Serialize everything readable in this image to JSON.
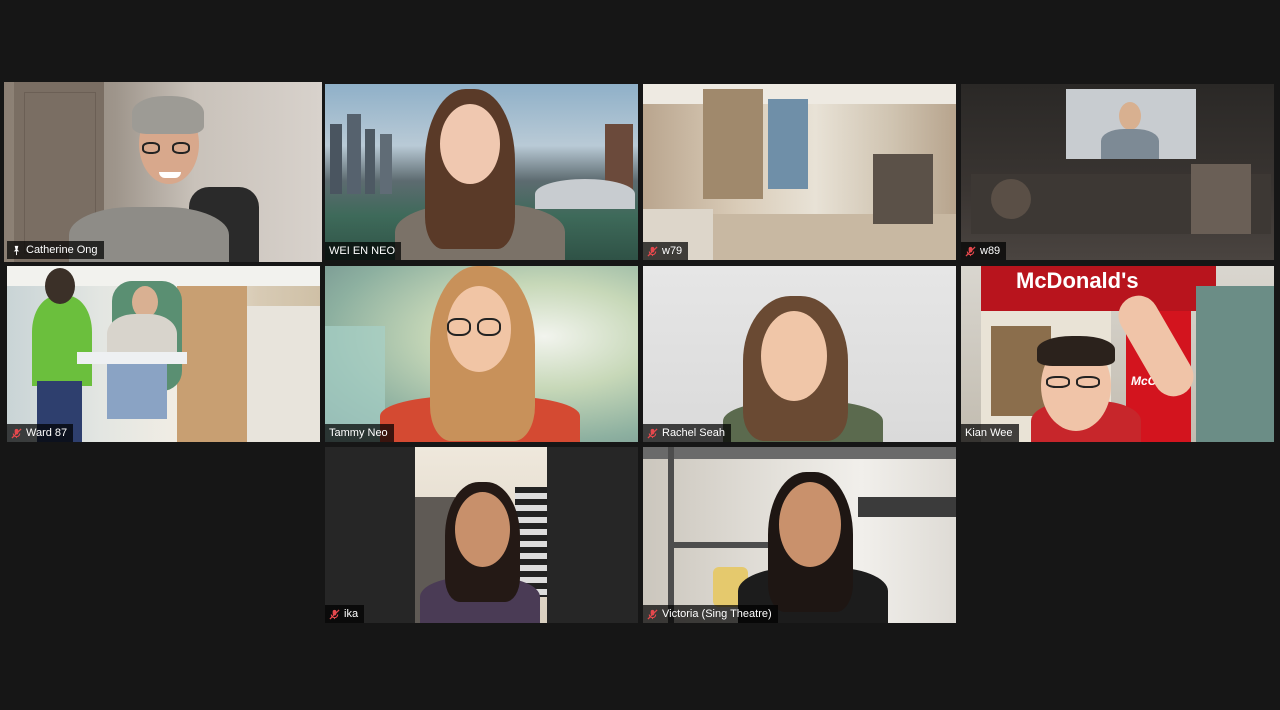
{
  "colors": {
    "background": "#161616",
    "active_speaker_border": "#d7e97e",
    "muted_icon": "#e5484d",
    "name_tag_bg": "#000000"
  },
  "participants": [
    {
      "name": "Catherine Ong",
      "icon": "pin-icon",
      "active_speaker": true
    },
    {
      "name": "WEI EN NEO",
      "icon": "",
      "active_speaker": false
    },
    {
      "name": "w79",
      "icon": "mic-muted-icon",
      "active_speaker": false
    },
    {
      "name": "w89",
      "icon": "mic-muted-icon",
      "active_speaker": false
    },
    {
      "name": "Ward 87",
      "icon": "mic-muted-icon",
      "active_speaker": false
    },
    {
      "name": "Tammy Neo",
      "icon": "",
      "active_speaker": false
    },
    {
      "name": "Rachel Seah",
      "icon": "mic-muted-icon",
      "active_speaker": false
    },
    {
      "name": "Kian Wee",
      "icon": "",
      "active_speaker": false
    },
    {
      "name": "ika",
      "icon": "mic-muted-icon",
      "active_speaker": false
    },
    {
      "name": "Victoria (Sing Theatre)",
      "icon": "mic-muted-icon",
      "active_speaker": false
    }
  ],
  "scene_text": {
    "mcdonalds_sign": "McDonald's",
    "mccafe_sign": "McCafé"
  }
}
